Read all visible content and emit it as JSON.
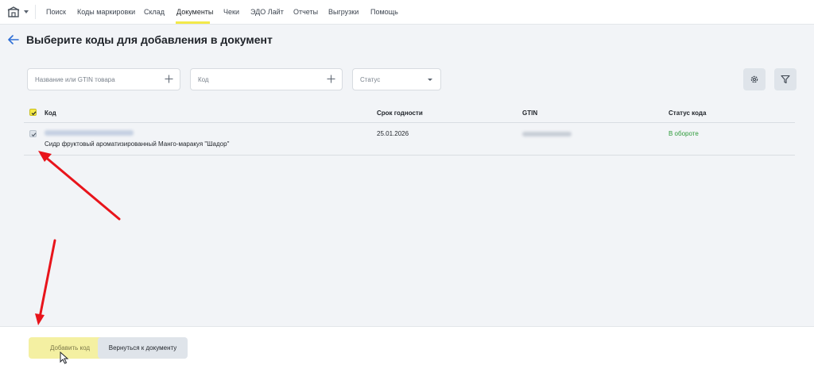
{
  "nav": {
    "logo_icon": "warehouse-icon",
    "items": [
      {
        "label": "Поиск"
      },
      {
        "label": "Коды маркировки"
      },
      {
        "label": "Склад"
      },
      {
        "label": "Документы",
        "active": true
      },
      {
        "label": "Чеки"
      },
      {
        "label": "ЭДО Лайт"
      },
      {
        "label": "Отчеты"
      },
      {
        "label": "Выгрузки"
      },
      {
        "label": "Помощь"
      }
    ]
  },
  "page": {
    "title": "Выберите коды для добавления в документ",
    "back_icon": "arrow-left-icon"
  },
  "filters": {
    "name_placeholder": "Название или GTIN товара",
    "code_placeholder": "Код",
    "status_placeholder": "Статус",
    "settings_icon": "gear-icon",
    "filter_icon": "funnel-icon"
  },
  "table": {
    "columns": [
      "Код",
      "Срок годности",
      "GTIN",
      "Статус кода"
    ],
    "rows": [
      {
        "code": "",
        "product": "Сидр фруктовый ароматизированный Манго-маракуя \"Шадор\"",
        "expiry": "25.01.2026",
        "gtin": "",
        "status": "В обороте"
      }
    ]
  },
  "footer": {
    "add_label": "Добавить код",
    "back_label": "Вернуться к документу"
  },
  "colors": {
    "accent_yellow": "#f5e948",
    "status_green": "#2e9b3a",
    "annotation_red": "#e8141b"
  }
}
